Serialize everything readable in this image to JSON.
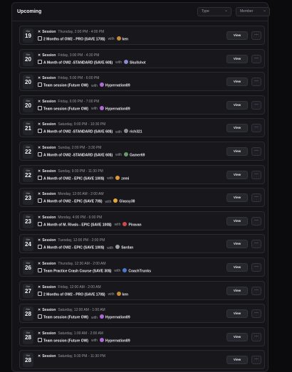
{
  "header": {
    "title": "Upcoming",
    "filters": [
      {
        "label": "Type",
        "icon": "chevron-down-icon"
      },
      {
        "label": "Member",
        "icon": "chevron-down-icon"
      }
    ]
  },
  "actions": {
    "view_label": "View",
    "more_label": "···"
  },
  "sessions": [
    {
      "month": "Mar",
      "day": "19",
      "kind": "Session",
      "time": "Thursday, 2:00 PM - 4:00 PM",
      "offer": "2 Months of OW2 - PRO (SAVE 170$)",
      "with": "with",
      "member": "ken",
      "avatar_color": "#c98a3a"
    },
    {
      "month": "Mar",
      "day": "20",
      "kind": "Session",
      "time": "Friday, 3:00 PM - 4:30 PM",
      "offer": "A Month of OW2 -STANDARD (SAVE 60$)",
      "with": "with",
      "member": "Skullshot",
      "avatar_color": "#8a8ad0"
    },
    {
      "month": "Mar",
      "day": "20",
      "kind": "Session",
      "time": "Friday, 5:00 PM - 6:00 PM",
      "offer": "Team session (Future OW)",
      "with": "with",
      "member": "Hypernation89",
      "avatar_color": "#b06ad8"
    },
    {
      "month": "Mar",
      "day": "20",
      "kind": "Session",
      "time": "Friday, 6:00 PM - 7:00 PM",
      "offer": "Team session (Future OW)",
      "with": "with",
      "member": "Hypernation89",
      "avatar_color": "#b06ad8"
    },
    {
      "month": "Mar",
      "day": "21",
      "kind": "Session",
      "time": "Saturday, 9:00 PM - 10:30 PM",
      "offer": "A Month of OW2 -STANDARD (SAVE 60$)",
      "with": "with",
      "member": "rich321",
      "avatar_color": "#8a8f96"
    },
    {
      "month": "Mar",
      "day": "22",
      "kind": "Session",
      "time": "Sunday, 2:00 PM - 3:30 PM",
      "offer": "A Month of OW2 -STANDARD (SAVE 60$)",
      "with": "with",
      "member": "Gamer69",
      "avatar_color": "#6a9a6a"
    },
    {
      "month": "Mar",
      "day": "22",
      "kind": "Session",
      "time": "Sunday, 9:30 PM - 11:30 PM",
      "offer": "A Month of OW2 - EPIC (SAVE 100$)",
      "with": "with",
      "member": "zemi",
      "avatar_color": "#e09a3a"
    },
    {
      "month": "Mar",
      "day": "23",
      "kind": "Session",
      "time": "Monday, 12:00 AM - 2:00 AM",
      "offer": "A Month of OW2 - EPIC (SAVE 70$)",
      "with": "with",
      "member": "Glassy38",
      "avatar_color": "#e8a83a"
    },
    {
      "month": "Mar",
      "day": "23",
      "kind": "Session",
      "time": "Monday, 4:00 PM - 6:00 PM",
      "offer": "A Month of M. Rivals - EPIC (SAVE 100$)",
      "with": "with",
      "member": "Piravan",
      "avatar_color": "#d04a4a"
    },
    {
      "month": "Mar",
      "day": "24",
      "kind": "Session",
      "time": "Tuesday, 12:00 PM - 2:00 PM",
      "offer": "A Month of OW2 - EPIC (SAVE 100$)",
      "with": "with",
      "member": "Sardan",
      "avatar_color": "#9aa0aa"
    },
    {
      "month": "Mar",
      "day": "26",
      "kind": "Session",
      "time": "Thursday, 12:30 AM - 2:00 AM",
      "offer": "Team Practice Crash Course (SAVE 30$)",
      "with": "with",
      "member": "CoachTrunks",
      "avatar_color": "#4a7ad0"
    },
    {
      "month": "Mar",
      "day": "27",
      "kind": "Session",
      "time": "Friday, 12:00 AM - 2:00 AM",
      "offer": "2 Months of OW2 - PRO (SAVE 170$)",
      "with": "with",
      "member": "ken",
      "avatar_color": "#c98a3a"
    },
    {
      "month": "Mar",
      "day": "28",
      "kind": "Session",
      "time": "Saturday, 12:00 AM - 1:00 AM",
      "offer": "Team session (Future OW)",
      "with": "with",
      "member": "Hypernation89",
      "avatar_color": "#b06ad8"
    },
    {
      "month": "Mar",
      "day": "28",
      "kind": "Session",
      "time": "Saturday, 1:00 AM - 2:00 AM",
      "offer": "Team session (Future OW)",
      "with": "with",
      "member": "Hypernation89",
      "avatar_color": "#b06ad8"
    },
    {
      "month": "Mar",
      "day": "28",
      "kind": "Session",
      "time": "Saturday, 9:30 PM - 11:30 PM",
      "offer": "",
      "with": "",
      "member": "",
      "avatar_color": "#8a8f96"
    }
  ]
}
